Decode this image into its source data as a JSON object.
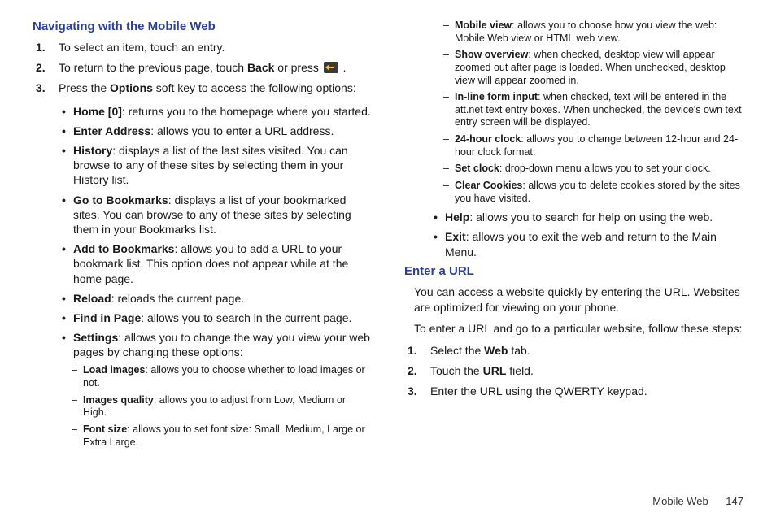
{
  "section1": {
    "title": "Navigating with the Mobile Web",
    "step1": "To select an item, touch an entry.",
    "step2_a": "To return to the previous page, touch ",
    "step2_b": "Back",
    "step2_c": " or press ",
    "step2_d": " .",
    "step3_a": "Press the ",
    "step3_b": "Options",
    "step3_c": " soft key to access the following options:",
    "bul": {
      "home_b": "Home [0]",
      "home_t": ": returns you to the homepage where you started.",
      "enter_b": "Enter Address",
      "enter_t": ": allows you to enter a URL address.",
      "hist_b": "History",
      "hist_t": ": displays a list of the last sites visited. You can browse to any of these sites by selecting them in your History list.",
      "gobm_b": "Go to Bookmarks",
      "gobm_t": ": displays a list of your bookmarked sites. You can browse to any of these sites by selecting them in your Bookmarks list.",
      "addbm_b": "Add to Bookmarks",
      "addbm_t": ": allows you to add a URL to your bookmark list. This option does not appear while at the home page.",
      "reload_b": "Reload",
      "reload_t": ": reloads the current page.",
      "find_b": "Find in Page",
      "find_t": ": allows you to search in the current page.",
      "set_b": "Settings",
      "set_t": ": allows you to change the way you view your web pages by changing these options:",
      "help_b": "Help",
      "help_t": ": allows you to search for help on using the web.",
      "exit_b": "Exit",
      "exit_t": ": allows you to exit the web and return to the Main Menu."
    },
    "dash": {
      "load_b": "Load images",
      "load_t": ": allows you to choose whether to load images or not.",
      "imgq_b": "Images quality",
      "imgq_t": ": allows you to adjust from Low, Medium or High.",
      "font_b": "Font size",
      "font_t": ": allows you to set font size: Small, Medium, Large or Extra Large.",
      "mview_b": "Mobile view",
      "mview_t": ": allows you to choose how you view the web: Mobile Web view or HTML web view.",
      "show_b": "Show overview",
      "show_t": ": when checked, desktop view will appear zoomed out after page is loaded. When unchecked, desktop view will appear zoomed in.",
      "inline_b": "In-line form input",
      "inline_t": ": when checked, text will be entered in the att.net text entry boxes. When unchecked, the device's own text entry screen will be displayed.",
      "clock_b": "24-hour clock",
      "clock_t": ": allows you to change between 12-hour and 24-hour clock format.",
      "setc_b": "Set clock",
      "setc_t": ": drop-down menu allows you to set your clock.",
      "clear_b": "Clear Cookies",
      "clear_t": ": allows you to delete cookies stored by the sites you have visited."
    }
  },
  "section2": {
    "title": "Enter a URL",
    "p1": "You can access a website quickly by entering the URL. Websites are optimized for viewing on your phone.",
    "p2": "To enter a URL and go to a particular website, follow these steps:",
    "s1a": "Select the ",
    "s1b": "Web",
    "s1c": " tab.",
    "s2a": "Touch the ",
    "s2b": "URL",
    "s2c": " field.",
    "s3": "Enter the URL using the QWERTY keypad."
  },
  "footer": {
    "label": "Mobile Web",
    "page": "147"
  }
}
